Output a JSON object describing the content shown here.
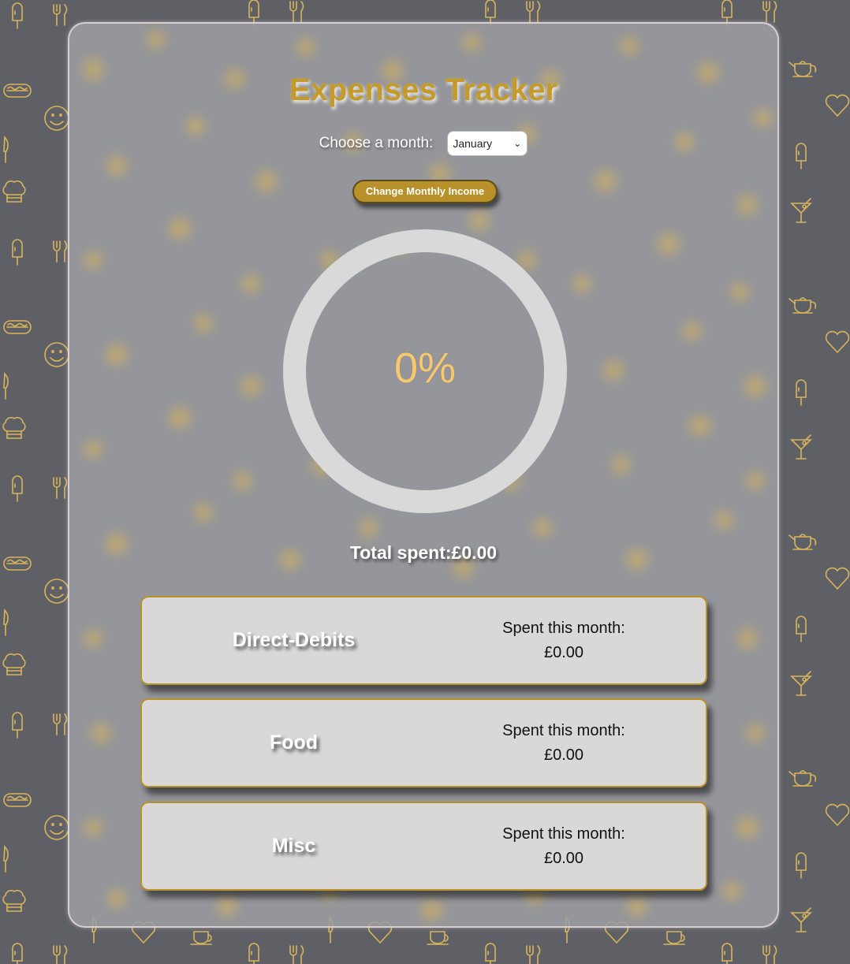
{
  "app": {
    "title": "Expenses Tracker"
  },
  "month_picker": {
    "label": "Choose a month:",
    "selected": "January"
  },
  "income_button": {
    "label": "Change Monthly Income"
  },
  "progress": {
    "percent_label": "0%",
    "value_fraction": 0
  },
  "total": {
    "text": "Total spent:£0.00"
  },
  "categories": [
    {
      "name": "Direct-Debits",
      "spent_label": "Spent this month:",
      "amount": "£0.00"
    },
    {
      "name": "Food",
      "spent_label": "Spent this month:",
      "amount": "£0.00"
    },
    {
      "name": "Misc",
      "spent_label": "Spent this month:",
      "amount": "£0.00"
    }
  ],
  "colors": {
    "accent_gold": "#b8912a",
    "title_gold": "#c49a2a",
    "percent_text": "#f7c76b",
    "ring_track": "#d9d9d9",
    "card_bg": "#d9d8d6",
    "page_bg": "#5f6066",
    "pattern_stroke": "#d8b45a"
  },
  "icons": [
    "ice-cream-icon",
    "fork-knife-icon",
    "hotdog-icon",
    "smiley-icon",
    "knife-icon",
    "chef-hat-icon",
    "teapot-icon",
    "heart-icon",
    "cocktail-icon",
    "cup-icon"
  ]
}
